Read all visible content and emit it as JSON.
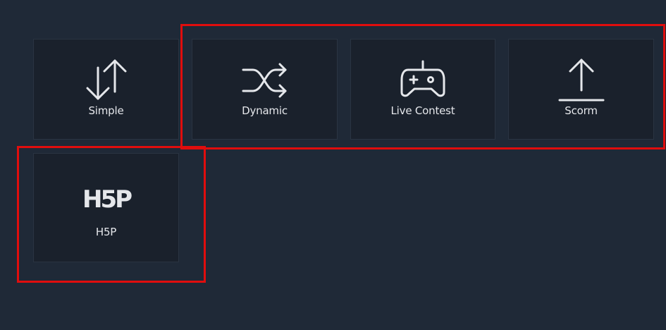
{
  "cards": [
    {
      "label": "Simple",
      "icon": "swap-vertical-icon"
    },
    {
      "label": "Dynamic",
      "icon": "shuffle-icon"
    },
    {
      "label": "Live Contest",
      "icon": "gamepad-icon"
    },
    {
      "label": "Scorm",
      "icon": "upload-icon"
    },
    {
      "label": "H5P",
      "icon": "h5p-logo-icon",
      "logo_text": "H5P"
    }
  ],
  "colors": {
    "background": "#1f2937",
    "card": "#1a212c",
    "highlight": "#e00d0d",
    "text": "#e5e7eb"
  }
}
